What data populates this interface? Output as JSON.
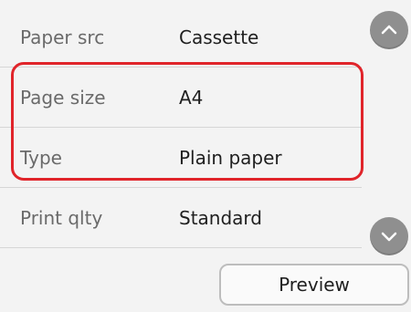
{
  "settings": {
    "rows": [
      {
        "label": "Paper src",
        "value": "Cassette"
      },
      {
        "label": "Page size",
        "value": "A4"
      },
      {
        "label": "Type",
        "value": "Plain paper"
      },
      {
        "label": "Print qlty",
        "value": "Standard"
      }
    ],
    "highlight_color": "#e0242a"
  },
  "scroll": {
    "up_icon": "chevron-up-icon",
    "down_icon": "chevron-down-icon"
  },
  "actions": {
    "preview_label": "Preview"
  }
}
